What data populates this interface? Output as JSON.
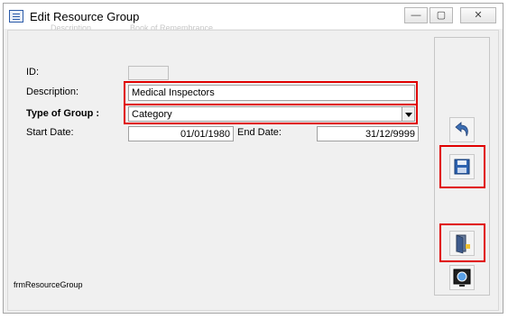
{
  "window": {
    "title": "Edit Resource Group",
    "ghost_text_1": "Description",
    "ghost_text_2": "Book of Remembrance"
  },
  "controls": {
    "minimize": "—",
    "maximize": "▢",
    "close": "✕"
  },
  "form": {
    "id_label": "ID:",
    "id_value": "",
    "description_label": "Description:",
    "description_value": "Medical Inspectors",
    "type_label": "Type of Group :",
    "type_value": "Category",
    "start_label": "Start Date:",
    "start_value": "01/01/1980",
    "end_label": "End Date:",
    "end_value": "31/12/9999"
  },
  "footer": {
    "form_name": "frmResourceGroup"
  },
  "sidebar": {
    "buttons": [
      "undo-icon",
      "save-icon",
      "exit-door-icon",
      "help-icon"
    ]
  },
  "colors": {
    "highlight": "#e00000",
    "window_bg": "#f0f0f0"
  }
}
